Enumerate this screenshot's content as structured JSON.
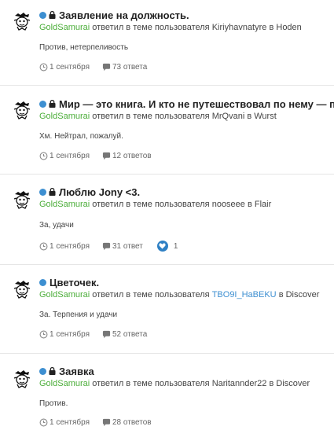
{
  "posts": [
    {
      "title": "Заявление на должность.",
      "locked": true,
      "user": "GoldSamurai",
      "action": "ответил в теме пользователя",
      "owner": "Kiriyhavnatyre",
      "owner_link": false,
      "in_word": "в",
      "forum": "Hoden",
      "excerpt": "Против, нетерпеливость",
      "date": "1 сентября",
      "replies": "73 ответа",
      "likes": ""
    },
    {
      "title": "Мир — это книга. И кто не путешествовал по нему — прочитал лишь одну страницу",
      "locked": true,
      "user": "GoldSamurai",
      "action": "ответил в теме пользователя",
      "owner": "MrQvani",
      "owner_link": false,
      "in_word": "в",
      "forum": "Wurst",
      "excerpt": "Хм. Нейтрал, пожалуй.",
      "date": "1 сентября",
      "replies": "12 ответов",
      "likes": ""
    },
    {
      "title": "Люблю Jony <3.",
      "locked": true,
      "user": "GoldSamurai",
      "action": "ответил в теме пользователя",
      "owner": "nooseee",
      "owner_link": false,
      "in_word": "в",
      "forum": "Flair",
      "excerpt": "За, удачи",
      "date": "1 сентября",
      "replies": "31 ответ",
      "likes": "1"
    },
    {
      "title": "Цветочек.",
      "locked": false,
      "user": "GoldSamurai",
      "action": "ответил в теме пользователя",
      "owner": "TBO9I_HaBEKU",
      "owner_link": true,
      "in_word": "в",
      "forum": "Discover",
      "excerpt": "За. Терпения и удачи",
      "date": "1 сентября",
      "replies": "52 ответа",
      "likes": ""
    },
    {
      "title": "Заявка",
      "locked": true,
      "user": "GoldSamurai",
      "action": "ответил в теме пользователя",
      "owner": "Naritannder22",
      "owner_link": false,
      "in_word": "в",
      "forum": "Discover",
      "excerpt": "Против.",
      "date": "1 сентября",
      "replies": "28 ответов",
      "likes": ""
    }
  ],
  "colors": {
    "unread_dot": "#3d8fd1",
    "username": "#4cae3a",
    "link": "#3d8fd1",
    "like_badge": "#2f80c4"
  },
  "icons": {
    "status": "unread-dot-icon",
    "lock": "lock-icon",
    "date": "clock-icon",
    "replies": "comment-bubble-icon",
    "likes": "heart-badge-icon",
    "avatar": "samurai-avatar-icon"
  }
}
